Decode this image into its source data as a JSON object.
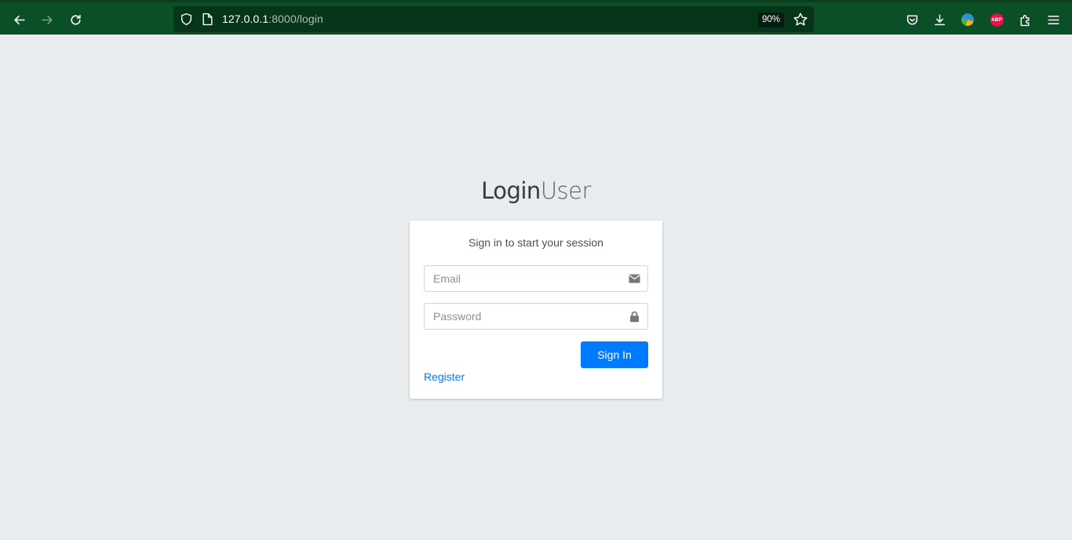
{
  "browser": {
    "url_host": "127.0.0.1",
    "url_rest": ":8000/login",
    "zoom": "90%",
    "extensions": {
      "abp_label": "ABP"
    }
  },
  "login": {
    "logo_bold": "Login",
    "logo_light": "User",
    "message": "Sign in to start your session",
    "email_placeholder": "Email",
    "password_placeholder": "Password",
    "signin_label": "Sign In",
    "register_label": "Register"
  },
  "colors": {
    "browser_bg": "#0b4f27",
    "page_bg": "#e9ecef",
    "primary": "#007bff"
  }
}
